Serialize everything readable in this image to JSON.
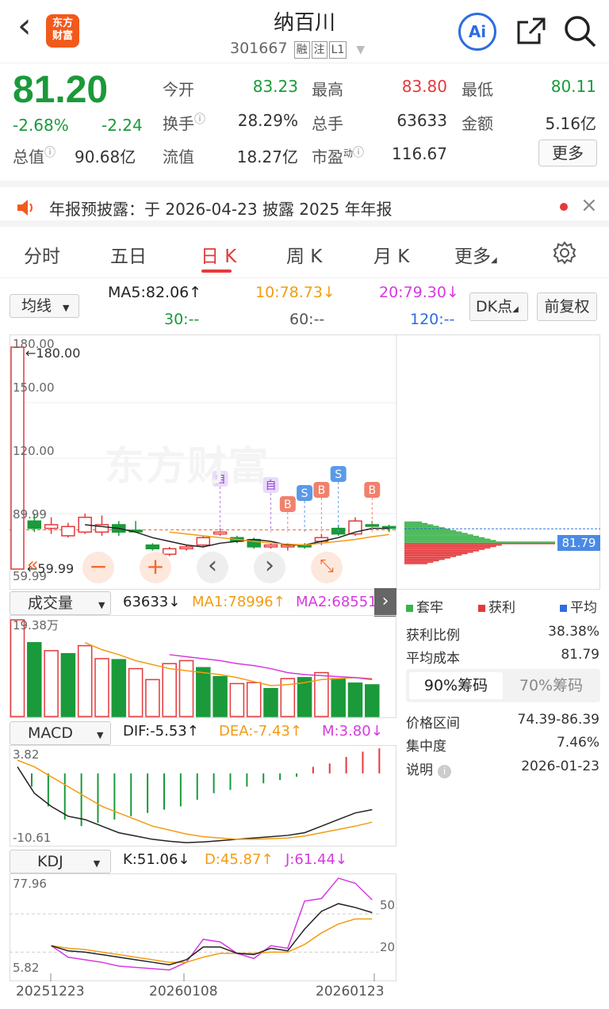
{
  "header": {
    "back": "‹",
    "logo_line1": "东方",
    "logo_line2": "财富",
    "title": "纳百川",
    "code": "301667",
    "tags": [
      "融",
      "注",
      "L1"
    ],
    "ai": "Ai"
  },
  "quote": {
    "price": "81.20",
    "change_pct": "-2.68%",
    "change": "-2.24",
    "total_value_label": "总值",
    "total_value": "90.68亿",
    "open_label": "今开",
    "open": "83.23",
    "high_label": "最高",
    "high": "83.80",
    "low_label": "最低",
    "low": "80.11",
    "turnover_label": "换手",
    "turnover": "28.29%",
    "volume_label": "总手",
    "volume": "63633",
    "amount_label": "金额",
    "amount": "5.16亿",
    "float_label": "流值",
    "float": "18.27亿",
    "pe_label": "市盈",
    "pe_sup": "动",
    "pe": "116.67",
    "more": "更多"
  },
  "notice": {
    "text": "年报预披露：于 2026-04-23 披露 2025 年年报"
  },
  "tabs": [
    "分时",
    "五日",
    "日 K",
    "周 K",
    "月 K",
    "更多"
  ],
  "ma_row": {
    "selector": "均线",
    "ma5": "MA5:82.06",
    "ma10": "10:78.73",
    "ma20": "20:79.30",
    "ma30": "30:--",
    "ma60": "60:--",
    "ma120": "120:--",
    "dk": "DK点",
    "adj": "前复权"
  },
  "kline": {
    "y_labels": [
      "180.00",
      "150.00",
      "120.00",
      "89.99",
      "59.99"
    ],
    "max_marker": "←180.00",
    "min_marker": "←59.99",
    "watermark": "东方财富",
    "dist_price": "81.79",
    "markers": [
      "自",
      "自",
      "B",
      "S",
      "B",
      "S",
      "B"
    ],
    "nav": [
      "−",
      "+",
      "‹",
      "›",
      "⤡"
    ],
    "candles": [
      {
        "o": 60,
        "c": 180,
        "h": 180,
        "l": 60,
        "up": true
      },
      {
        "o": 86,
        "c": 82,
        "h": 90,
        "l": 80,
        "up": false
      },
      {
        "o": 84,
        "c": 82,
        "h": 88,
        "l": 79,
        "up": true
      },
      {
        "o": 83,
        "c": 78,
        "h": 85,
        "l": 77,
        "up": true
      },
      {
        "o": 80,
        "c": 88,
        "h": 90,
        "l": 79,
        "up": true
      },
      {
        "o": 84,
        "c": 80,
        "h": 89,
        "l": 78,
        "up": true
      },
      {
        "o": 84,
        "c": 80,
        "h": 86,
        "l": 78,
        "up": false
      },
      {
        "o": 81,
        "c": 81,
        "h": 86,
        "l": 80,
        "up": false
      },
      {
        "o": 73,
        "c": 71,
        "h": 74,
        "l": 70,
        "up": false
      },
      {
        "o": 68,
        "c": 71,
        "h": 72,
        "l": 67,
        "up": true
      },
      {
        "o": 71,
        "c": 72,
        "h": 73,
        "l": 70,
        "up": true
      },
      {
        "o": 73,
        "c": 77,
        "h": 78,
        "l": 72,
        "up": true
      },
      {
        "o": 79,
        "c": 80,
        "h": 82,
        "l": 78,
        "up": true
      },
      {
        "o": 77,
        "c": 75,
        "h": 78,
        "l": 74,
        "up": false
      },
      {
        "o": 76,
        "c": 72,
        "h": 77,
        "l": 71,
        "up": false
      },
      {
        "o": 72,
        "c": 73,
        "h": 74,
        "l": 71,
        "up": true
      },
      {
        "o": 72,
        "c": 73,
        "h": 74,
        "l": 70,
        "up": true
      },
      {
        "o": 73,
        "c": 72,
        "h": 74,
        "l": 71,
        "up": false
      },
      {
        "o": 75,
        "c": 77,
        "h": 79,
        "l": 73,
        "up": true
      },
      {
        "o": 79,
        "c": 82,
        "h": 84,
        "l": 78,
        "up": false
      },
      {
        "o": 79,
        "c": 86,
        "h": 88,
        "l": 78,
        "up": true
      },
      {
        "o": 84,
        "c": 84,
        "h": 86,
        "l": 82,
        "up": false
      },
      {
        "o": 82,
        "c": 83,
        "h": 84,
        "l": 80,
        "up": false
      }
    ]
  },
  "volume": {
    "selector": "成交量",
    "value": "63633",
    "ma1": "MA1:78996",
    "ma2": "MA2:68551",
    "max_label": "19.38万",
    "bars": [
      19.38,
      14.8,
      13.2,
      12.6,
      14.2,
      11.6,
      11.4,
      9.6,
      7.4,
      10.6,
      11.2,
      9.8,
      8.0,
      6.6,
      6.8,
      5.6,
      7.6,
      7.8,
      8.8,
      7.6,
      6.7,
      6.36
    ],
    "bar_up": [
      true,
      false,
      true,
      false,
      true,
      true,
      false,
      true,
      true,
      true,
      true,
      false,
      false,
      true,
      true,
      false,
      true,
      false,
      true,
      false,
      false,
      false
    ]
  },
  "macd": {
    "selector": "MACD",
    "dif": "DIF:-5.53",
    "dea": "DEA:-7.43",
    "m": "M:3.80",
    "max_label": "3.82",
    "min_label": "-10.61"
  },
  "kdj": {
    "selector": "KDJ",
    "k": "K:51.06",
    "d": "D:45.87",
    "j": "J:61.44",
    "max_label": "77.96",
    "min_label": "5.82",
    "level50": "50",
    "level20": "20"
  },
  "dates": [
    "20251223",
    "20260108",
    "20260123"
  ],
  "right_panel": {
    "legend": [
      "套牢",
      "获利",
      "平均"
    ],
    "profit_ratio_label": "获利比例",
    "profit_ratio": "38.38%",
    "avg_cost_label": "平均成本",
    "avg_cost": "81.79",
    "tab_90": "90%筹码",
    "tab_70": "70%筹码",
    "range_label": "价格区间",
    "range": "74.39-86.39",
    "concentration_label": "集中度",
    "concentration": "7.46%",
    "note_label": "说明",
    "note_date": "2026-01-23"
  },
  "colors": {
    "up": "#e4393c",
    "down": "#1a9a3a",
    "orange": "#f39c12",
    "magenta": "#d63adf",
    "blue": "#2e6de0"
  }
}
